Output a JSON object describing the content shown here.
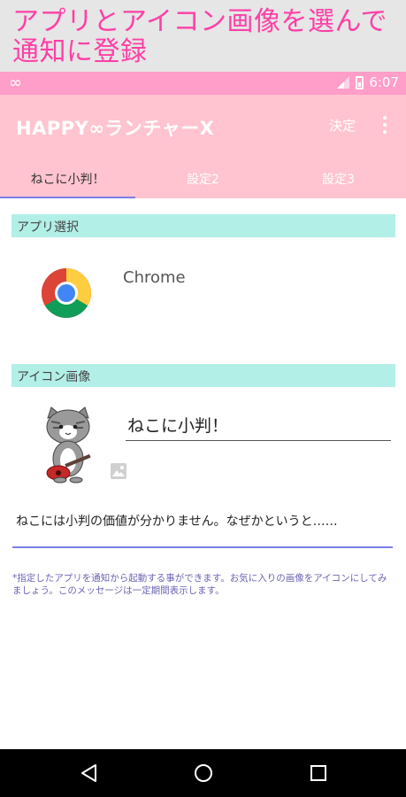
{
  "banner": {
    "text": "アプリとアイコン画像を選んで通知に登録"
  },
  "status_bar": {
    "left_icon": "∞",
    "time": "6:07"
  },
  "app_bar": {
    "title": "HAPPY∞ランチャーX",
    "action_ok": "決定"
  },
  "tabs": [
    {
      "label": "ねこに小判！",
      "active": true
    },
    {
      "label": "設定2",
      "active": false
    },
    {
      "label": "設定3",
      "active": false
    }
  ],
  "app_section": {
    "header": "アプリ選択",
    "app_name": "Chrome"
  },
  "icon_section": {
    "header": "アイコン画像",
    "name_value": "ねこに小判！"
  },
  "message": {
    "value": "ねこには小判の価値が分かりません。なぜかというと……"
  },
  "note": {
    "text": "*指定したアプリを通知から起動する事ができます。お気に入りの画像をアイコンにしてみましょう。このメッセージは一定期間表示します。"
  },
  "colors": {
    "banner_text": "#ff3fa6",
    "status_bar": "#ff9ec9",
    "app_bar": "#ffc4cf",
    "section_header": "#b2efe7",
    "accent": "#7d7ee8"
  }
}
